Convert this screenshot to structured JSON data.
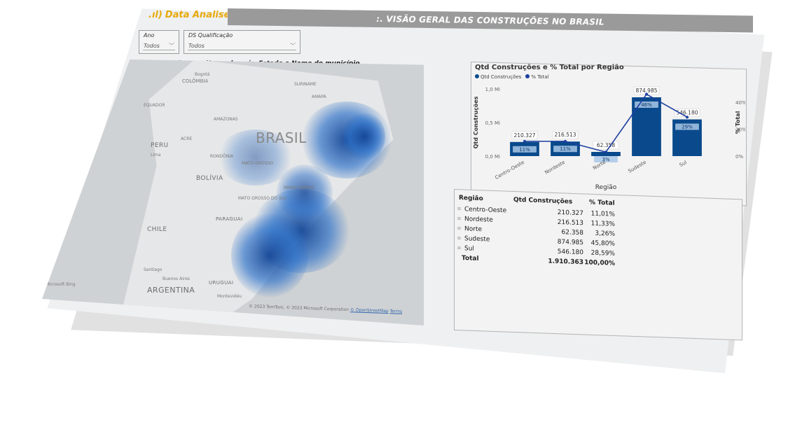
{
  "header": {
    "logo_text": "Data Analise",
    "title": ":. VISÃO GERAL DAS CONSTRUÇÕES NO BRASIL"
  },
  "colors": {
    "logo": "#e8a90a",
    "header_bar": "#9a9a9a",
    "bar_dark": "#0a4a8c",
    "bar_light": "#a9c7e6",
    "line": "#1d3fa0"
  },
  "slicers": {
    "ano": {
      "label": "Ano",
      "value": "Todos"
    },
    "ds_qualificacao": {
      "label": "DS Qualificação",
      "value": "Todos"
    }
  },
  "map": {
    "title": "Qtd Construções por Nome do país, Estado e Nome do município",
    "labels": {
      "brasil": "BRASIL",
      "peru": "PERU",
      "lima": "Lima",
      "bolivia": "BOLÍVIA",
      "chile": "CHILE",
      "argentina": "ARGENTINA",
      "paraguai": "PARAGUAI",
      "uruguai": "URUGUAI",
      "santiago": "Santiago",
      "buenos_aires": "Buenos Aires",
      "montevideu": "Montevidéu",
      "bogota": "Bogotá",
      "colombia": "COLÔMBIA",
      "equador": "EQUADOR",
      "suriname": "SURINAME",
      "amazonas": "AMAZONAS",
      "amapa": "AMAPÁ",
      "acre": "ACRE",
      "rondonia": "RONDÔNIA",
      "mato_grosso": "MATO GROSSO",
      "mato_grosso_sul": "MATO GROSSO DO SUL",
      "minas_gerais": "MINAS GERAIS"
    },
    "copyright": "© 2023 TomTom, © 2023 Microsoft Corporation",
    "copyright_link": "© OpenStreetMap",
    "terms": "Terms",
    "bing": "Microsoft Bing"
  },
  "chart_data": {
    "type": "bar",
    "title": "Qtd Construções e % Total por Região",
    "legend": [
      "Qtd Construções",
      "% Total"
    ],
    "categories": [
      "Centro-Oeste",
      "Nordeste",
      "Norte",
      "Sudeste",
      "Sul"
    ],
    "series": [
      {
        "name": "Qtd Construções",
        "values": [
          210327,
          216513,
          62358,
          874985,
          546180
        ]
      },
      {
        "name": "% Total",
        "values": [
          11,
          11,
          3,
          46,
          29
        ]
      }
    ],
    "value_labels": [
      "210.327",
      "216.513",
      "62.358",
      "874.985",
      "546.180"
    ],
    "pct_labels": [
      "11%",
      "11%",
      "3%",
      "46%",
      "29%"
    ],
    "xlabel": "Região",
    "ylabel": "Qtd Construções",
    "y2label": "% Total",
    "y_ticks": [
      "1,0 Mi",
      "0,5 Mi",
      "0,0 Mi"
    ],
    "y2_ticks": [
      "40%",
      "20%",
      "0%"
    ],
    "ylim": [
      0,
      1000000
    ],
    "y2lim": [
      0,
      50
    ]
  },
  "table": {
    "headers": [
      "Região",
      "Qtd Construções",
      "% Total"
    ],
    "rows": [
      {
        "regiao": "Centro-Oeste",
        "qtd": "210.327",
        "pct": "11,01%"
      },
      {
        "regiao": "Nordeste",
        "qtd": "216.513",
        "pct": "11,33%"
      },
      {
        "regiao": "Norte",
        "qtd": "62.358",
        "pct": "3,26%"
      },
      {
        "regiao": "Sudeste",
        "qtd": "874.985",
        "pct": "45,80%"
      },
      {
        "regiao": "Sul",
        "qtd": "546.180",
        "pct": "28,59%"
      }
    ],
    "total": {
      "label": "Total",
      "qtd": "1.910.363",
      "pct": "100,00%"
    }
  }
}
